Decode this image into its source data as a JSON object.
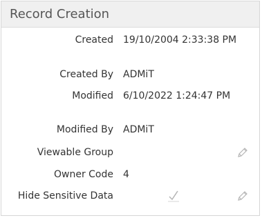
{
  "panel": {
    "title": "Record Creation"
  },
  "fields": [
    {
      "label": "Created",
      "value": "19/10/2004 2:33:38 PM"
    },
    {
      "label": "Created By",
      "value": "ADMiT"
    },
    {
      "label": "Modified",
      "value": "6/10/2022 1:24:47 PM"
    },
    {
      "label": "Modified By",
      "value": "ADMiT"
    },
    {
      "label": "Viewable Group",
      "value": ""
    },
    {
      "label": "Owner Code",
      "value": "4"
    },
    {
      "label": "Hide Sensitive Data",
      "checked": true
    }
  ],
  "icons": {
    "edit": "pencil-icon",
    "check": "checkmark-icon"
  },
  "colors": {
    "header_bg": "#f0f0f0",
    "border": "#d6d6d6",
    "text": "#333333",
    "icon": "#b5b5b5"
  }
}
